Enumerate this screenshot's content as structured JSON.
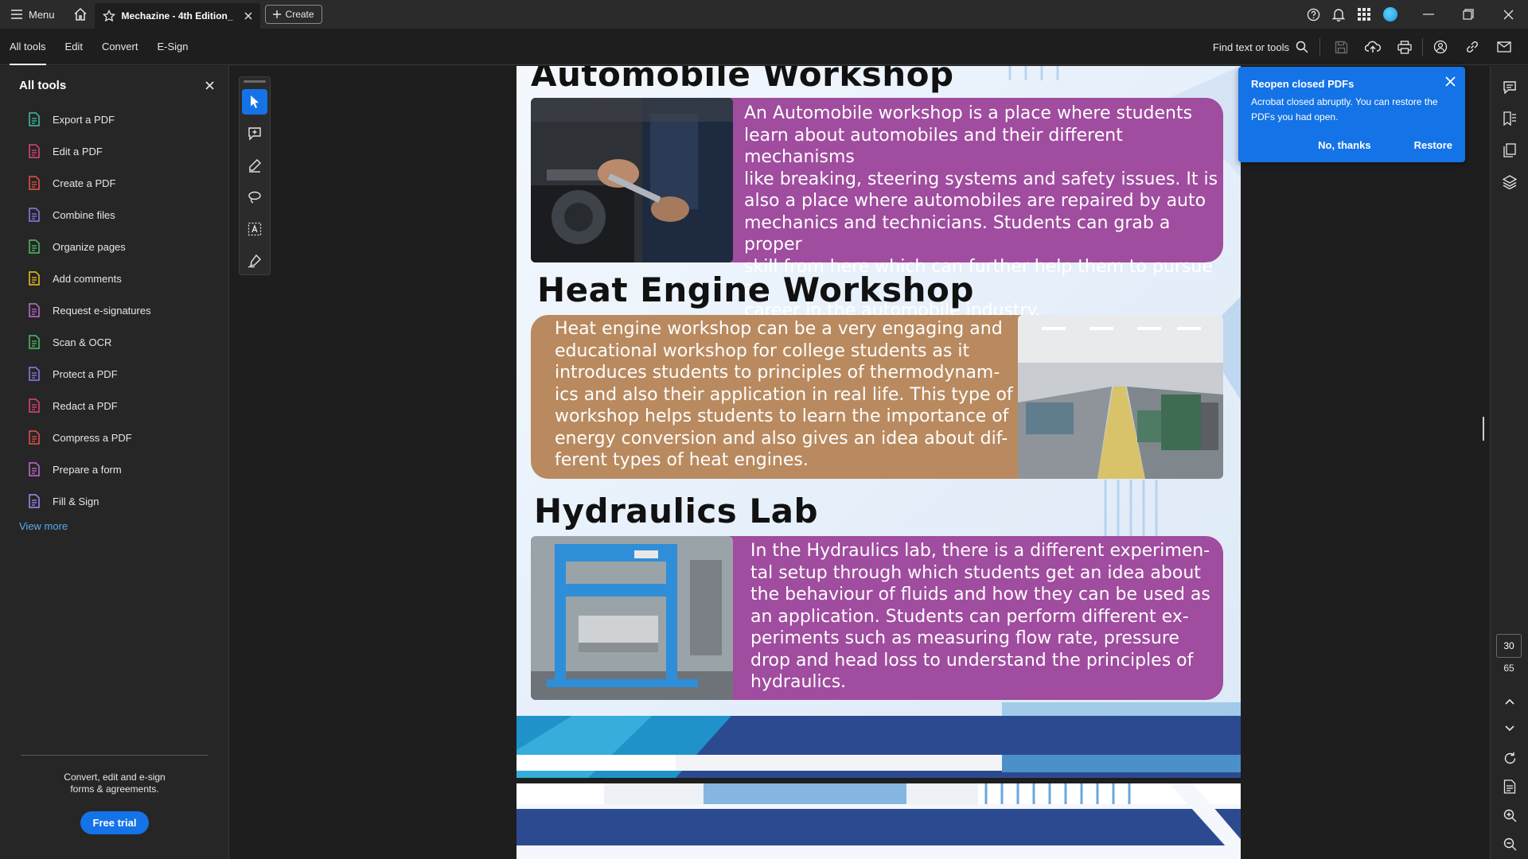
{
  "titlebar": {
    "menu_label": "Menu",
    "tab_title": "Mechazine - 4th Edition_",
    "create_label": "Create"
  },
  "toolbar": {
    "tabs": [
      {
        "label": "All tools"
      },
      {
        "label": "Edit"
      },
      {
        "label": "Convert"
      },
      {
        "label": "E-Sign"
      }
    ],
    "find_label": "Find text or tools"
  },
  "left_panel": {
    "title": "All tools",
    "tools": [
      {
        "label": "Export a PDF",
        "icon": "export-pdf-icon",
        "color": "#3ec2a3"
      },
      {
        "label": "Edit a PDF",
        "icon": "edit-pdf-icon",
        "color": "#e0457b"
      },
      {
        "label": "Create a PDF",
        "icon": "create-pdf-icon",
        "color": "#e8534a"
      },
      {
        "label": "Combine files",
        "icon": "combine-files-icon",
        "color": "#8f7df0"
      },
      {
        "label": "Organize pages",
        "icon": "organize-pages-icon",
        "color": "#4cc164"
      },
      {
        "label": "Add comments",
        "icon": "add-comments-icon",
        "color": "#f5c21b"
      },
      {
        "label": "Request e-signatures",
        "icon": "request-esignatures-icon",
        "color": "#c36ad8"
      },
      {
        "label": "Scan & OCR",
        "icon": "scan-ocr-icon",
        "color": "#4cc164"
      },
      {
        "label": "Protect a PDF",
        "icon": "protect-pdf-icon",
        "color": "#8f7df0"
      },
      {
        "label": "Redact a PDF",
        "icon": "redact-pdf-icon",
        "color": "#e0457b"
      },
      {
        "label": "Compress a PDF",
        "icon": "compress-pdf-icon",
        "color": "#e8534a"
      },
      {
        "label": "Prepare a form",
        "icon": "prepare-form-icon",
        "color": "#c36ad8"
      },
      {
        "label": "Fill & Sign",
        "icon": "fill-sign-icon",
        "color": "#a78bf5"
      }
    ],
    "view_more": "View more",
    "footer_line1": "Convert, edit and e-sign",
    "footer_line2": "forms & agreements.",
    "trial_label": "Free trial"
  },
  "document": {
    "sections": [
      {
        "title": "Automobile Workshop",
        "lines": [
          "An Automobile workshop is a place where students",
          "learn about automobiles and their different mechanisms",
          "like breaking, steering systems and safety issues. It is",
          "also a place where automobiles are repaired by auto",
          "mechanics and technicians. Students can grab a proper",
          "skill from here which can further help them to pursue a",
          "career in the automobile industry."
        ]
      },
      {
        "title": "Heat Engine Workshop",
        "lines": [
          "Heat engine workshop can be a very engaging and",
          "educational workshop for college students as it",
          "introduces students to principles of thermodynam-",
          "ics and also their application in real life. This type of",
          "workshop helps students to learn the importance of",
          "energy conversion and also gives an idea about dif-",
          "ferent types of heat engines."
        ]
      },
      {
        "title": "Hydraulics Lab",
        "lines": [
          "In the Hydraulics lab, there is a different experimen-",
          "tal setup through which students get an idea about",
          "the behaviour of fluids and how they can be used as",
          "an application. Students can perform different ex-",
          "periments such as measuring flow rate, pressure",
          "drop and head loss to understand the principles of",
          "hydraulics."
        ]
      }
    ]
  },
  "notification": {
    "title": "Reopen closed PDFs",
    "body": "Acrobat closed abruptly. You can restore the PDFs you had open.",
    "dismiss_label": "No, thanks",
    "restore_label": "Restore"
  },
  "right_rail": {
    "page_current": "30",
    "page_total": "65"
  },
  "colors": {
    "accent": "#1473e6",
    "box_purple": "#a04c9f",
    "box_tan": "#b98a5f"
  }
}
